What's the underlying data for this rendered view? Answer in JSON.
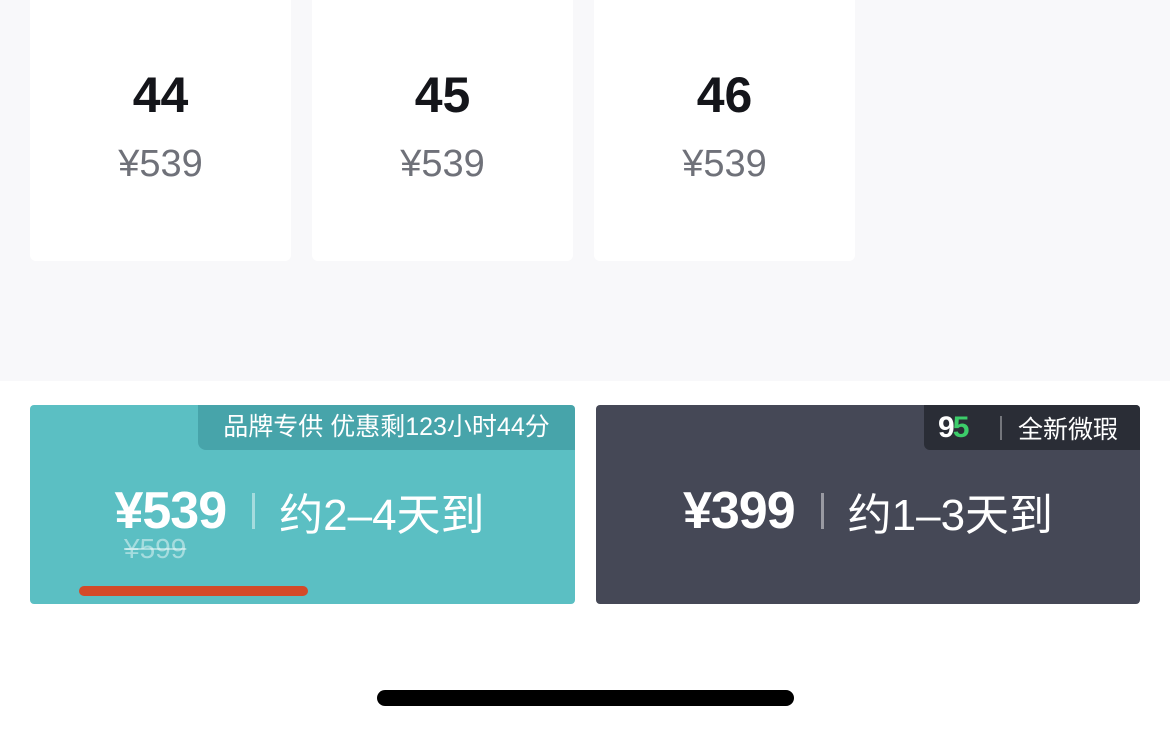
{
  "colors": {
    "brand_bg": "#5bbfc3",
    "dark_bg": "#454856",
    "accent_red": "#d34a28",
    "logo_green": "#3ccd6a"
  },
  "sizes": [
    {
      "size": "44",
      "price": "¥539"
    },
    {
      "size": "45",
      "price": "¥539"
    },
    {
      "size": "46",
      "price": "¥539"
    }
  ],
  "brand_option": {
    "promo_tag": "品牌专供 优惠剩123小时44分",
    "price": "¥539",
    "original_price": "¥599",
    "delivery": "约2–4天到"
  },
  "new_option": {
    "logo_digits": [
      "9",
      "5"
    ],
    "condition": "全新微瑕",
    "price": "¥399",
    "delivery": "约1–3天到"
  }
}
